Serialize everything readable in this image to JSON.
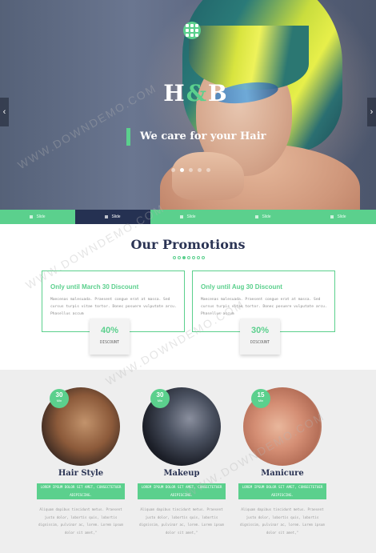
{
  "hero": {
    "brand_h": "H",
    "brand_amp": "&",
    "brand_b": "B",
    "tagline": "We care for your Hair",
    "prev_arrow": "‹",
    "next_arrow": "›"
  },
  "slidebar": {
    "tabs": [
      "Slide",
      "Slide",
      "Slide",
      "Slide",
      "Slide"
    ],
    "active_index": 1
  },
  "promotions": {
    "title": "Our Promotions",
    "cards": [
      {
        "heading": "Only until March 30 Discount",
        "text": "Maecenas malesuada. Praesent congue erat at massa. Sed cursus turpis vitae tortor. Donec posuere vulputate arcu. Phasellus accum",
        "percent": "40%",
        "label": "DISCOUNT"
      },
      {
        "heading": "Only until Aug 30 Discount",
        "text": "Maecenas malesuada. Praesent congue erat at massa. Sed cursus turpis vitae tortor. Donec posuere vulputate arcu. Phasellus accum",
        "percent": "30%",
        "label": "DISCOUNT"
      }
    ]
  },
  "services": [
    {
      "number": "30",
      "unit": "Min",
      "name": "Hair Style",
      "subtitle": "LOREM IPSUM DOLOR SIT AMET, CONSECTETUER ADIPISCING.",
      "description": "Aliquam dapibus tincidunt metus. Praesent justo dolor, lobortis quis, lobortis dignissim, pulvinar ac, lorem. Lorem ipsum dolor sit amet,\""
    },
    {
      "number": "30",
      "unit": "Min",
      "name": "Makeup",
      "subtitle": "LOREM IPSUM DOLOR SIT AMET, CONSECTETUER ADIPISCING.",
      "description": "Aliquam dapibus tincidunt metus. Praesent justo dolor, lobortis quis, lobortis dignissim, pulvinar ac, lorem. Lorem ipsum dolor sit amet,\""
    },
    {
      "number": "15",
      "unit": "Min",
      "name": "Manicure",
      "subtitle": "LOREM IPSUM DOLOR SIT AMET, CONSECTETUER ADIPISCING.",
      "description": "Aliquam dapibus tincidunt metus. Praesent justo dolor, lobortis quis, lobortis dignissim, pulvinar ac, lorem. Lorem ipsum dolor sit amet,\""
    }
  ],
  "watermark": "WWW.DOWNDEMO.COM",
  "colors": {
    "accent_green": "#5bd08d",
    "navy": "#2b3454",
    "active_tab": "#253152"
  }
}
